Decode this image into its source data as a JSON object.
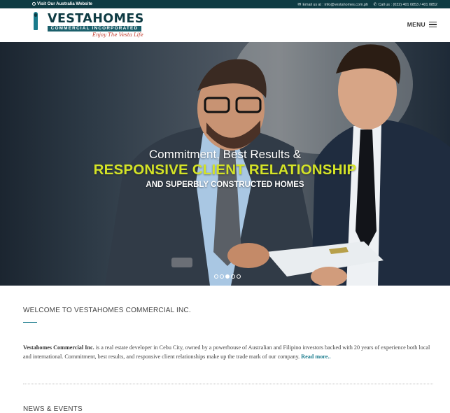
{
  "topbar": {
    "australia_link": "Visit Our Australia Website",
    "email": "Email us at : info@vestahomes.com.ph",
    "call": "Call us : (032) 401 0853 / 401 0852",
    "icons": [
      "external-link-icon",
      "envelope-icon",
      "phone-icon"
    ]
  },
  "header": {
    "logo_name": "VESTAHOMES",
    "logo_band": "COMMERCIAL INCORPORATED",
    "logo_tagline": "Enjoy The Vesta Life",
    "menu_label": "MENU"
  },
  "hero": {
    "line1": "Commitment, Best Results &",
    "line2": "RESPONSIVE CLIENT RELATIONSHIP",
    "line3": "AND SUPERBLY CONSTRUCTED HOMES",
    "slides": 5,
    "active_slide": 3
  },
  "welcome": {
    "heading": "WELCOME TO VESTAHOMES COMMERCIAL INC.",
    "company": "Vestahomes Commercial Inc.",
    "body": " is a real estate developer in Cebu City, owned by a powerhouse of Australian and Filipino investors backed with 20 years of experience both local and international. Commitment, best results, and responsive client relationships make up the trade mark of our company. ",
    "read_more": "Read more.."
  },
  "news": {
    "heading": "NEWS & EVENTS"
  },
  "colors": {
    "brand_dark": "#0e3b43",
    "brand_teal": "#1a7b8c",
    "hero_accent": "#d4e327"
  }
}
